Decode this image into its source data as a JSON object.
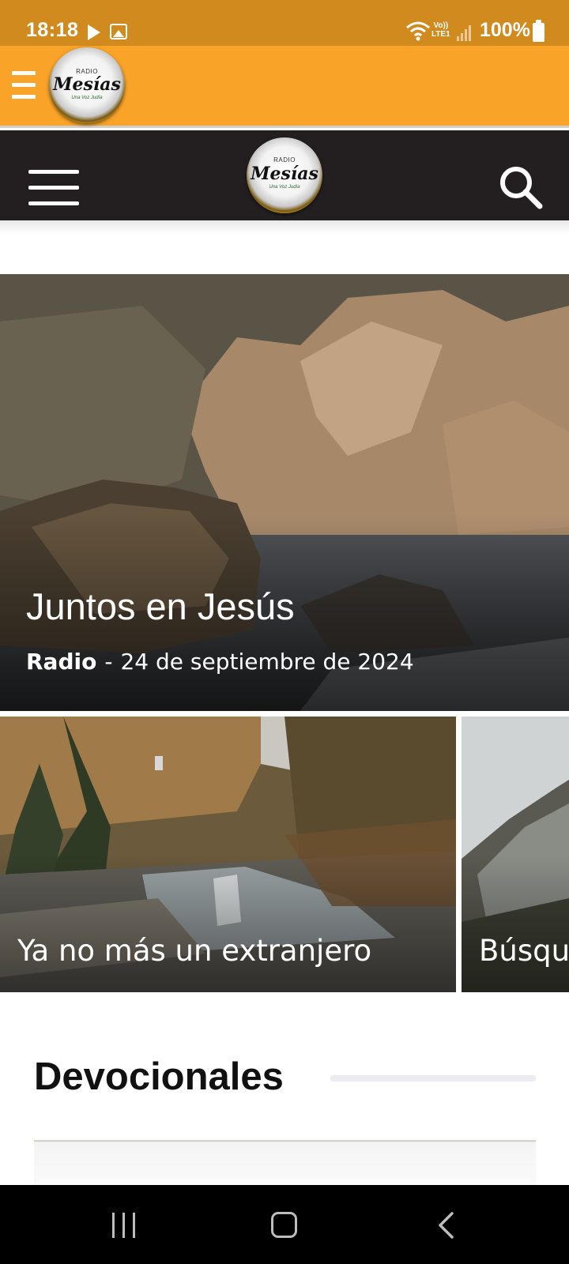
{
  "status_bar": {
    "time": "18:18",
    "volte_top": "Vo))",
    "volte_bottom": "LTE1",
    "battery": "100%",
    "icons": [
      "play-icon",
      "gallery-icon",
      "wifi-icon",
      "volte-icon",
      "signal-icon",
      "battery-icon"
    ]
  },
  "app_bar": {
    "menu_icon": "hamburger-icon",
    "logo": {
      "top": "RADIO",
      "main": "Mesías",
      "sub": "Una Voz Judía"
    }
  },
  "site_header": {
    "menu_icon": "hamburger-icon",
    "search_icon": "search-icon"
  },
  "featured": {
    "title": "Juntos en Jesús",
    "category": "Radio",
    "separator": "-",
    "date": "24 de septiembre de 2024"
  },
  "carousel": [
    {
      "title": "Ya no más un extranjero"
    },
    {
      "title": "Búsqu"
    }
  ],
  "section": {
    "title": "Devocionales"
  },
  "nav_bar": {
    "icons": [
      "recents-icon",
      "home-icon",
      "back-icon"
    ]
  },
  "colors": {
    "status_bar": "#d08a1e",
    "app_bar": "#f9a428",
    "site_header": "#231f20",
    "nav_bar": "#000000"
  }
}
